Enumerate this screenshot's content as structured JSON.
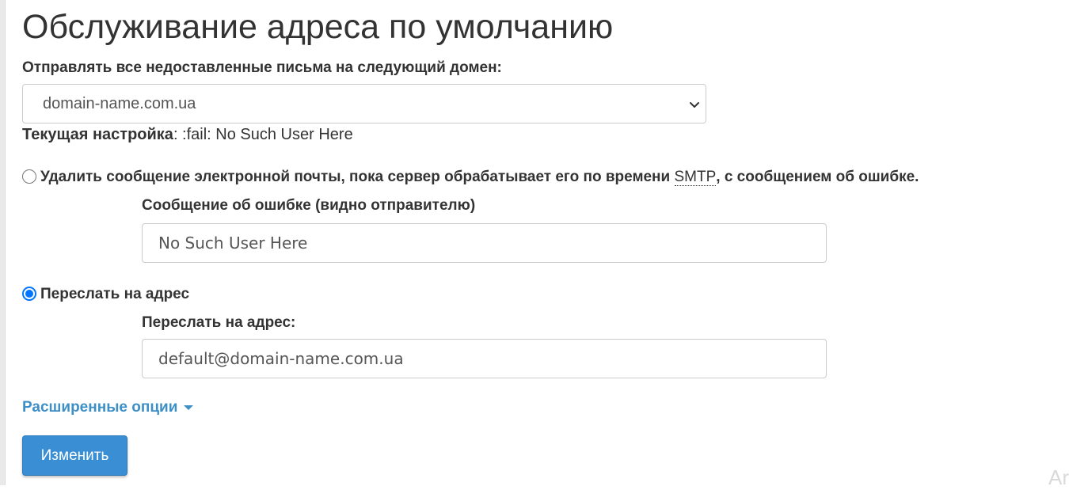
{
  "page": {
    "title": "Обслуживание адреса по умолчанию"
  },
  "domain_select": {
    "label": "Отправлять все недоставленные письма на следующий домен:",
    "selected": "domain-name.com.ua"
  },
  "current_setting": {
    "label": "Текущая настройка",
    "separator": ":",
    "value": " :fail: No Such User Here"
  },
  "option_fail": {
    "label_before": "Удалить сообщение электронной почты, пока сервер обрабатывает его по времени ",
    "abbr": "SMTP",
    "label_after": ", с сообщением об ошибке.",
    "checked": false,
    "message_label": "Сообщение об ошибке (видно отправителю)",
    "message_value": "No Such User Here"
  },
  "option_forward": {
    "label": "Переслать на адрес",
    "checked": true,
    "address_label": "Переслать на адрес:",
    "address_value": "default@domain-name.com.ua"
  },
  "advanced": {
    "label": "Расширенные опции"
  },
  "submit": {
    "label": "Изменить"
  },
  "corner_fragment": {
    "text": "Ar"
  },
  "colors": {
    "link": "#3d8fc6",
    "button": "#3a8fd4",
    "radio_checked": "#0075ff",
    "text": "#333333"
  }
}
